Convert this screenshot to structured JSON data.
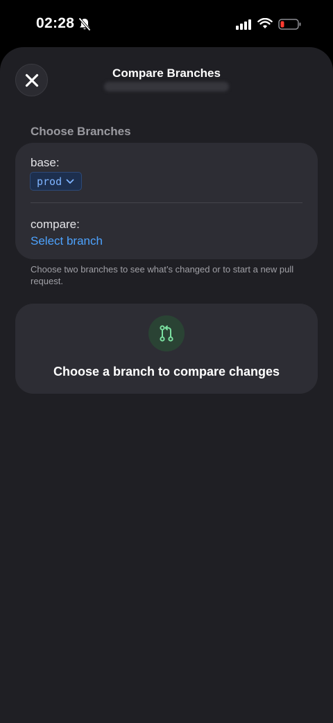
{
  "status_bar": {
    "time": "02:28"
  },
  "header": {
    "title": "Compare Branches"
  },
  "section": {
    "heading": "Choose Branches"
  },
  "branches": {
    "base_label": "base:",
    "base_value": "prod",
    "compare_label": "compare:",
    "compare_value": "Select branch"
  },
  "helper_text": "Choose two branches to see what’s changed or to start a new pull request.",
  "empty_state": {
    "icon": "git-compare-icon",
    "message": "Choose a branch to compare changes"
  },
  "colors": {
    "accent": "#4da3ff",
    "chip_text": "#7fb4ff",
    "battery_low": "#ff3b30",
    "compare_icon": "#7be0a0"
  }
}
